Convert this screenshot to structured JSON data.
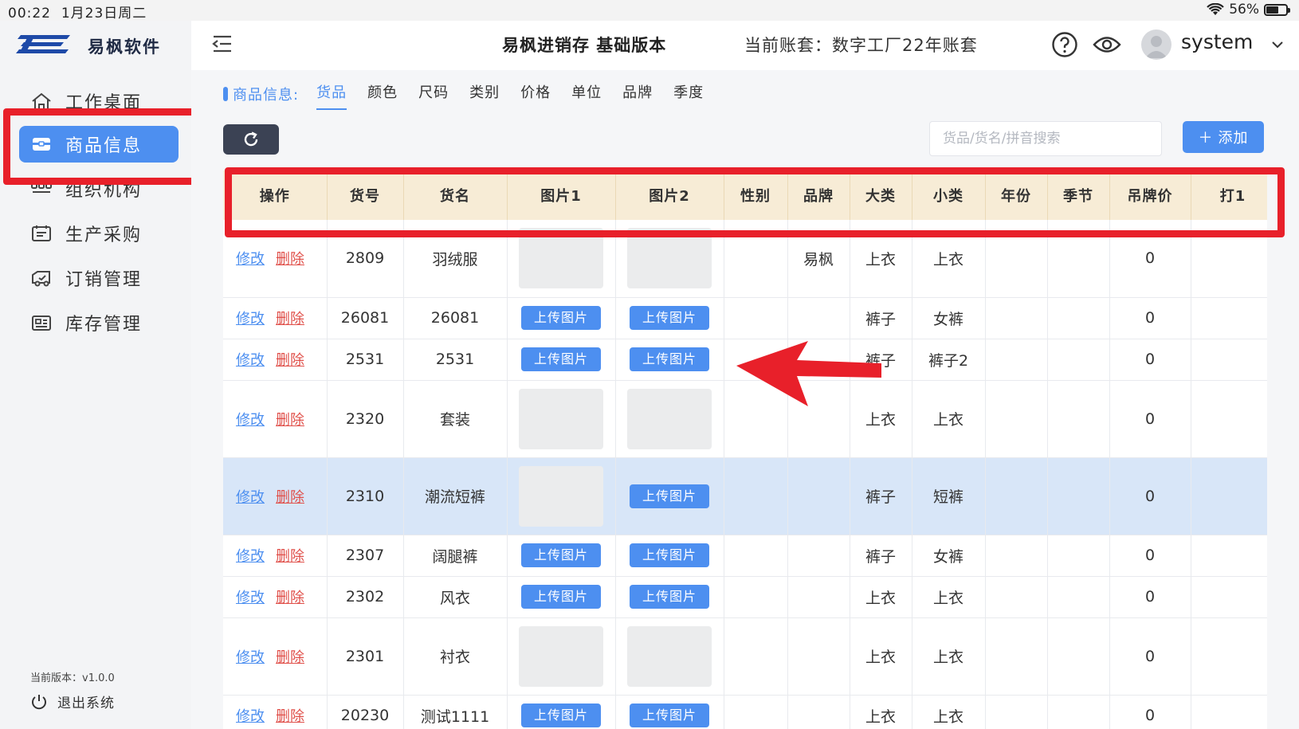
{
  "status_bar": {
    "time": "00:22",
    "date": "1月23日周二",
    "battery": "56%"
  },
  "brand": {
    "name": "易枫软件"
  },
  "sidebar": {
    "items": [
      {
        "label": "工作桌面",
        "icon": "home-icon"
      },
      {
        "label": "商品信息",
        "icon": "product-icon"
      },
      {
        "label": "组织机构",
        "icon": "org-icon"
      },
      {
        "label": "生产采购",
        "icon": "purchase-icon"
      },
      {
        "label": "订销管理",
        "icon": "sales-icon"
      },
      {
        "label": "库存管理",
        "icon": "inventory-icon"
      }
    ],
    "active_item": "商品信息",
    "version": "当前版本：v1.0.0",
    "logout": "退出系统"
  },
  "header": {
    "app_title": "易枫进销存 基础版本",
    "account": "当前账套：数字工厂22年账套",
    "username": "system"
  },
  "tabs": {
    "prefix": "商品信息:",
    "items": [
      "货品",
      "颜色",
      "尺码",
      "类别",
      "价格",
      "单位",
      "品牌",
      "季度"
    ],
    "active": "货品"
  },
  "toolbar": {
    "search_placeholder": "货品/货名/拼音搜索",
    "add_label": "添加"
  },
  "table": {
    "columns": [
      "操作",
      "货号",
      "货名",
      "图片1",
      "图片2",
      "性别",
      "品牌",
      "大类",
      "小类",
      "年份",
      "季节",
      "吊牌价",
      "打1"
    ],
    "edit_label": "修改",
    "delete_label": "删除",
    "upload_label": "上传图片",
    "rows": [
      {
        "code": "2809",
        "name": "羽绒服",
        "img1": "image",
        "img2": "image",
        "gender": "",
        "brand": "易枫",
        "category": "上衣",
        "subcategory": "上衣",
        "year": "",
        "season": "",
        "tag_price": "0"
      },
      {
        "code": "26081",
        "name": "26081",
        "img1": "upload",
        "img2": "upload",
        "gender": "",
        "brand": "",
        "category": "裤子",
        "subcategory": "女裤",
        "year": "",
        "season": "",
        "tag_price": "0"
      },
      {
        "code": "2531",
        "name": "2531",
        "img1": "upload",
        "img2": "upload",
        "gender": "",
        "brand": "",
        "category": "裤子",
        "subcategory": "裤子2",
        "year": "",
        "season": "",
        "tag_price": "0"
      },
      {
        "code": "2320",
        "name": "套装",
        "img1": "image",
        "img2": "image",
        "gender": "",
        "brand": "",
        "category": "上衣",
        "subcategory": "上衣",
        "year": "",
        "season": "",
        "tag_price": "0"
      },
      {
        "code": "2310",
        "name": "潮流短裤",
        "img1": "image",
        "img2": "upload",
        "gender": "",
        "brand": "",
        "category": "裤子",
        "subcategory": "短裤",
        "year": "",
        "season": "",
        "tag_price": "0",
        "selected": true
      },
      {
        "code": "2307",
        "name": "阔腿裤",
        "img1": "upload",
        "img2": "upload",
        "gender": "",
        "brand": "",
        "category": "裤子",
        "subcategory": "女裤",
        "year": "",
        "season": "",
        "tag_price": "0"
      },
      {
        "code": "2302",
        "name": "风衣",
        "img1": "upload",
        "img2": "upload",
        "gender": "",
        "brand": "",
        "category": "上衣",
        "subcategory": "上衣",
        "year": "",
        "season": "",
        "tag_price": "0"
      },
      {
        "code": "2301",
        "name": "衬衣",
        "img1": "image",
        "img2": "image",
        "gender": "",
        "brand": "",
        "category": "上衣",
        "subcategory": "上衣",
        "year": "",
        "season": "",
        "tag_price": "0"
      },
      {
        "code": "20230",
        "name": "测试1111",
        "img1": "upload",
        "img2": "upload",
        "gender": "",
        "brand": "",
        "category": "上衣",
        "subcategory": "上衣",
        "year": "",
        "season": "",
        "tag_price": "0"
      }
    ]
  },
  "colors": {
    "accent": "#4d8ff0",
    "highlight": "#e8202a",
    "header_bg": "#f7ecd6",
    "selected_row": "#d8e6f8",
    "danger": "#e0504a"
  }
}
